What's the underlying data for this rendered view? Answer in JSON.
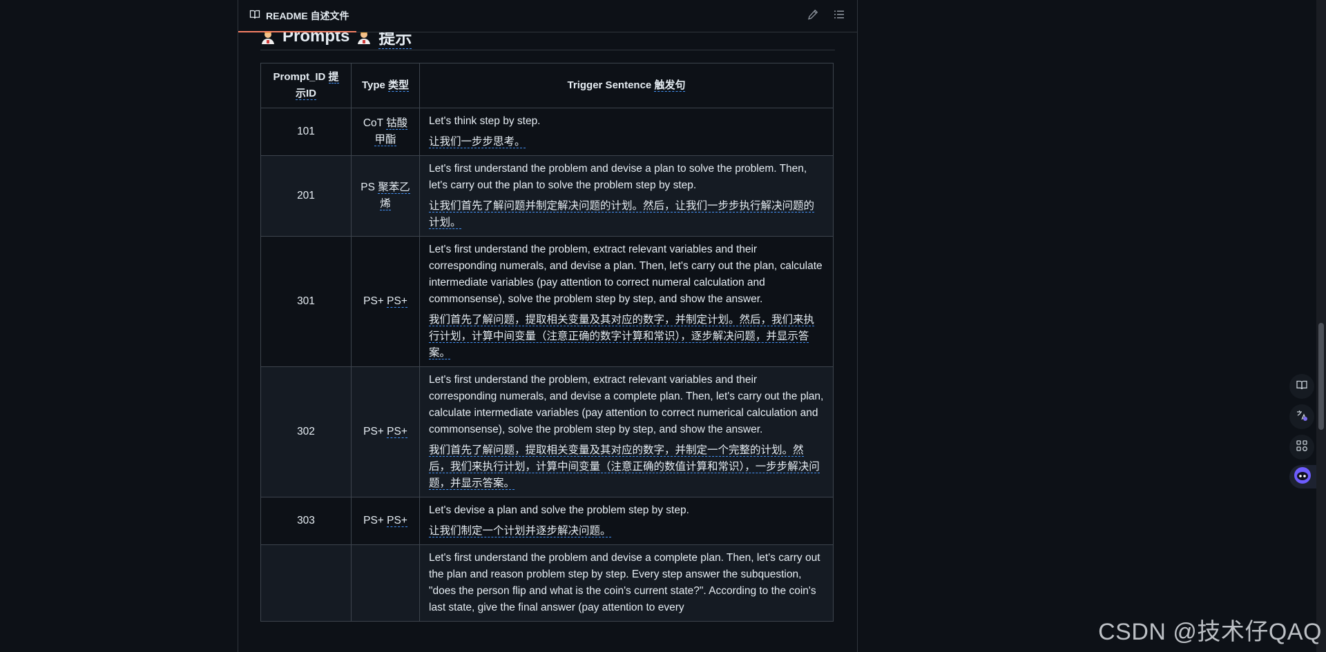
{
  "header": {
    "tab_label": "README 自述文件",
    "icons": [
      "book-icon",
      "pencil-icon",
      "list-icon"
    ]
  },
  "section": {
    "title_en": "Prompts",
    "title_zh": "提示"
  },
  "table": {
    "headers": {
      "id_en": "Prompt_ID",
      "id_zh": "提示ID",
      "type_en": "Type",
      "type_zh": "类型",
      "trigger_en": "Trigger Sentence",
      "trigger_zh": "触发句"
    },
    "rows": [
      {
        "id": "101",
        "type_en": "CoT",
        "type_zh": "钴酸甲酯",
        "en": "Let's think step by step.",
        "zh": "让我们一步步思考。"
      },
      {
        "id": "201",
        "type_en": "PS",
        "type_zh": "聚苯乙烯",
        "en": "Let's first understand the problem and devise a plan to solve the problem. Then, let's carry out the plan to solve the problem step by step.",
        "zh": "让我们首先了解问题并制定解决问题的计划。然后，让我们一步步执行解决问题的计划。"
      },
      {
        "id": "301",
        "type_en": "PS+",
        "type_zh": "PS+",
        "en": "Let's first understand the problem, extract relevant variables and their corresponding numerals, and devise a plan. Then, let's carry out the plan, calculate intermediate variables (pay attention to correct numeral calculation and commonsense), solve the problem step by step, and show the answer.",
        "zh": "我们首先了解问题，提取相关变量及其对应的数字，并制定计划。然后，我们来执行计划，计算中间变量（注意正确的数字计算和常识），逐步解决问题，并显示答案。"
      },
      {
        "id": "302",
        "type_en": "PS+",
        "type_zh": "PS+",
        "en": "Let's first understand the problem, extract relevant variables and their corresponding numerals, and devise a complete plan. Then, let's carry out the plan, calculate intermediate variables (pay attention to correct numerical calculation and commonsense), solve the problem step by step, and show the answer.",
        "zh": "我们首先了解问题，提取相关变量及其对应的数字，并制定一个完整的计划。然后，我们来执行计划，计算中间变量（注意正确的数值计算和常识），一步步解决问题，并显示答案。"
      },
      {
        "id": "303",
        "type_en": "PS+",
        "type_zh": "PS+",
        "en": "Let's devise a plan and solve the problem step by step.",
        "zh": "让我们制定一个计划并逐步解决问题。"
      },
      {
        "id": "",
        "type_en": "",
        "type_zh": "",
        "en": "Let's first understand the problem and devise a complete plan. Then, let's carry out the plan and reason problem step by step. Every step answer the subquestion, \"does the person flip and what is the coin's current state?\". According to the coin's last state, give the final answer (pay attention to every",
        "zh": ""
      }
    ]
  },
  "watermark": "CSDN @技术仔QAQ",
  "side_dock": [
    "book-icon",
    "translate-icon",
    "apps-icon",
    "assistant-bot-icon"
  ],
  "colors": {
    "background": "#0d1117",
    "border": "#3d444d",
    "accent_underline": "#4493f8",
    "tab_indicator": "#f78166"
  }
}
